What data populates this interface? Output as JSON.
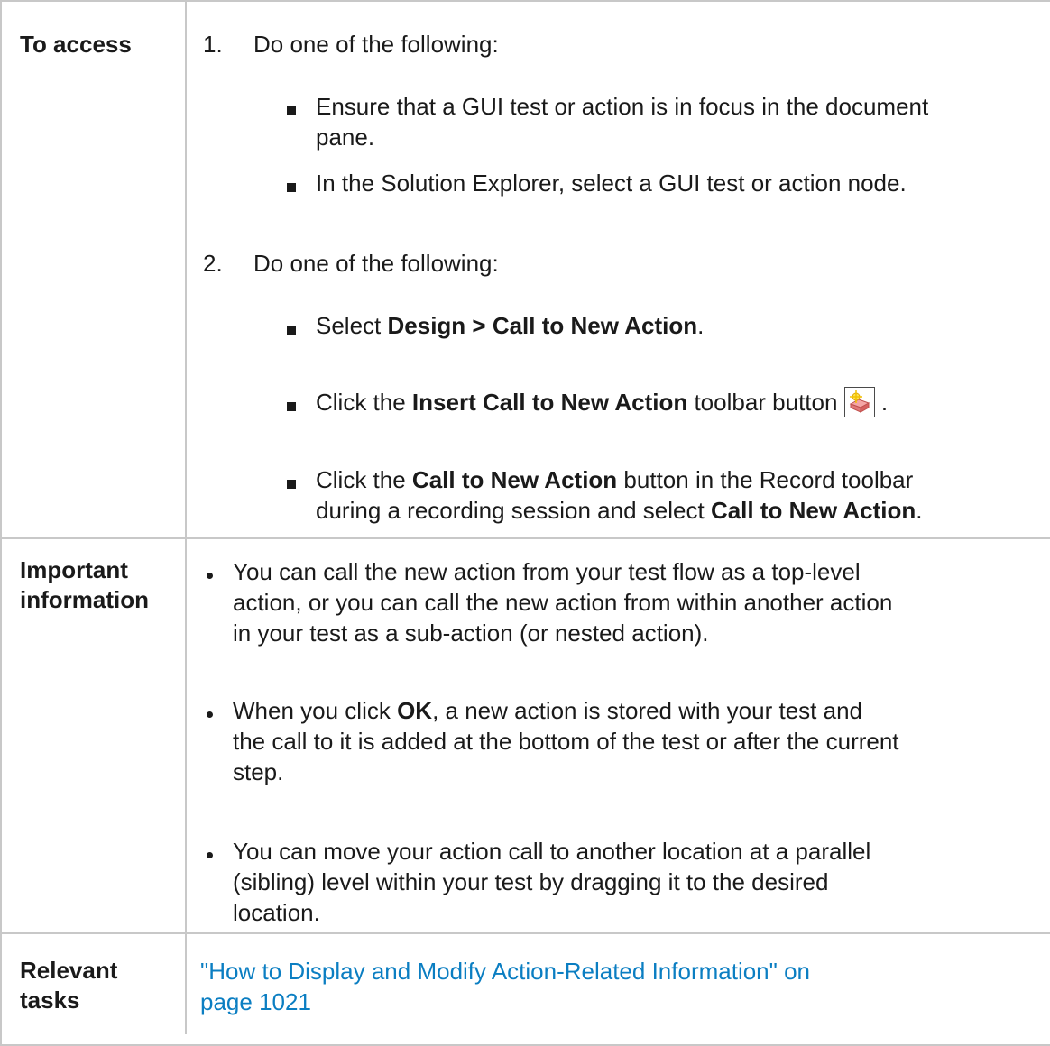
{
  "table": {
    "rows": [
      {
        "label": "To access",
        "steps": [
          {
            "number": "1.",
            "text": "Do one of the following:",
            "bullets": [
              {
                "line1": "Ensure that a GUI test or action is in focus in the document",
                "line2": "pane."
              },
              {
                "line1": "In the Solution Explorer, select a GUI test or action node."
              }
            ]
          },
          {
            "number": "2.",
            "text": "Do one of the following:",
            "bullets": [
              {
                "pre": "Select ",
                "bold": "Design > Call to New Action",
                "post": "."
              },
              {
                "pre": "Click the ",
                "bold": "Insert Call to New Action",
                "post": " toolbar button",
                "icon": "insert-call-to-new-action-icon",
                "after_icon": "."
              },
              {
                "pre": "Click the ",
                "bold": "Call to New Action",
                "post": " button in the Record toolbar",
                "line2_pre": "during a recording session and select ",
                "line2_bold": "Call to New Action",
                "line2_post": "."
              }
            ]
          }
        ]
      },
      {
        "label_line1": "Important",
        "label_line2": "information",
        "bullets": [
          {
            "line1": "You can call the new action from your test flow as a top-level",
            "line2": "action, or you can call the new action from within another action",
            "line3": "in your test as a sub-action (or nested action)."
          },
          {
            "pre": "When you click ",
            "bold": "OK",
            "post": ", a new action is stored with your test and",
            "line2": "the call to it is added at the bottom of the test or after the current",
            "line3": "step."
          },
          {
            "line1": "You can move your action call to another location at a parallel",
            "line2": "(sibling) level within your test by dragging it to the desired",
            "line3": "location."
          }
        ]
      },
      {
        "label_line1": "Relevant",
        "label_line2": "tasks",
        "link_line1": "\"How to Display and Modify Action-Related Information\" on",
        "link_line2": "page 1021"
      }
    ]
  },
  "colors": {
    "link": "#0b7ec2",
    "border": "#c8c8c8",
    "text": "#1a1a1a"
  }
}
